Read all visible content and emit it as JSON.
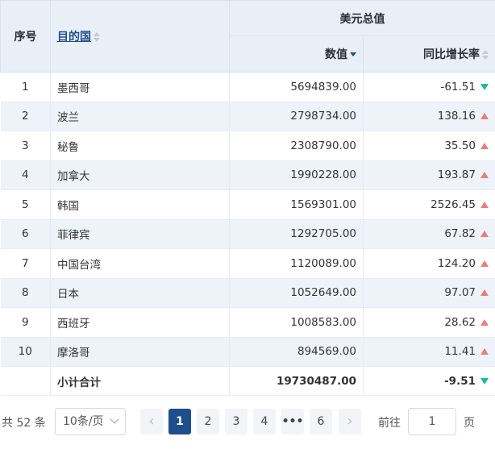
{
  "table": {
    "headers": {
      "index": "序号",
      "country": "目的国",
      "group": "美元总值",
      "value": "数值",
      "growth": "同比增长率"
    },
    "rows": [
      {
        "index": "1",
        "country": "墨西哥",
        "value": "5694839.00",
        "growth": "-61.51",
        "trend": "down"
      },
      {
        "index": "2",
        "country": "波兰",
        "value": "2798734.00",
        "growth": "138.16",
        "trend": "up"
      },
      {
        "index": "3",
        "country": "秘鲁",
        "value": "2308790.00",
        "growth": "35.50",
        "trend": "up"
      },
      {
        "index": "4",
        "country": "加拿大",
        "value": "1990228.00",
        "growth": "193.87",
        "trend": "up"
      },
      {
        "index": "5",
        "country": "韩国",
        "value": "1569301.00",
        "growth": "2526.45",
        "trend": "up"
      },
      {
        "index": "6",
        "country": "菲律宾",
        "value": "1292705.00",
        "growth": "67.82",
        "trend": "up"
      },
      {
        "index": "7",
        "country": "中国台湾",
        "value": "1120089.00",
        "growth": "124.20",
        "trend": "up"
      },
      {
        "index": "8",
        "country": "日本",
        "value": "1052649.00",
        "growth": "97.07",
        "trend": "up"
      },
      {
        "index": "9",
        "country": "西班牙",
        "value": "1008583.00",
        "growth": "28.62",
        "trend": "up"
      },
      {
        "index": "10",
        "country": "摩洛哥",
        "value": "894569.00",
        "growth": "11.41",
        "trend": "up"
      }
    ],
    "subtotal": {
      "label": "小计合计",
      "value": "19730487.00",
      "growth": "-9.51",
      "trend": "down"
    }
  },
  "pagination": {
    "total": "共 52 条",
    "page_size": "10条/页",
    "pages": [
      "1",
      "2",
      "3",
      "4",
      "•••",
      "6"
    ],
    "current_page": "1",
    "goto_label": "前往",
    "goto_value": "1",
    "page_suffix": "页"
  },
  "colors": {
    "accent": "#1f4e8c",
    "up": "#e57f7f",
    "down": "#1fb89a",
    "header_bg": "#e8eff7",
    "stripe_bg": "#eef3f9"
  }
}
